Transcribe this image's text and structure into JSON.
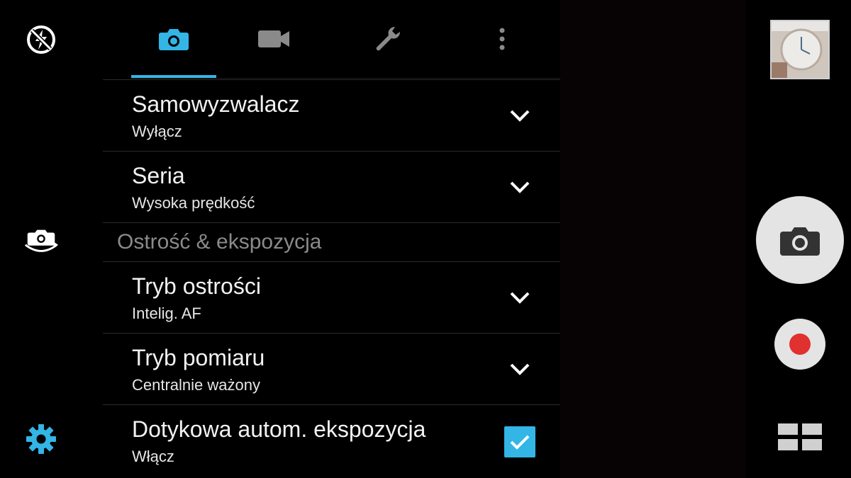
{
  "left_bar": {
    "flash_icon": "flash-off-icon",
    "switch_camera_icon": "switch-camera-icon",
    "settings_icon": "gear-icon"
  },
  "tabs": [
    {
      "icon": "camera-icon",
      "active": true
    },
    {
      "icon": "video-camera-icon",
      "active": false
    },
    {
      "icon": "wrench-icon",
      "active": false
    },
    {
      "icon": "more-vert-icon",
      "active": false
    }
  ],
  "settings": {
    "self_timer": {
      "title": "Samowyzwalacz",
      "value": "Wyłącz"
    },
    "burst": {
      "title": "Seria",
      "value": "Wysoka prędkość"
    },
    "section_focus_exposure": "Ostrość & ekspozycja",
    "focus_mode": {
      "title": "Tryb ostrości",
      "value": "Intelig. AF"
    },
    "metering_mode": {
      "title": "Tryb pomiaru",
      "value": "Centralnie ważony"
    },
    "touch_auto_exposure": {
      "title": "Dotykowa autom. ekspozycja",
      "value": "Włącz",
      "checked": true
    }
  },
  "right_bar": {
    "gallery_thumbnail": "last-photo-thumbnail",
    "shutter_icon": "camera-icon",
    "record_icon": "record-icon",
    "modes_icon": "grid-modes-icon"
  },
  "colors": {
    "accent": "#33b5e5",
    "record": "#e03030",
    "background": "#000000",
    "secondary_text": "#8a8a8a"
  }
}
